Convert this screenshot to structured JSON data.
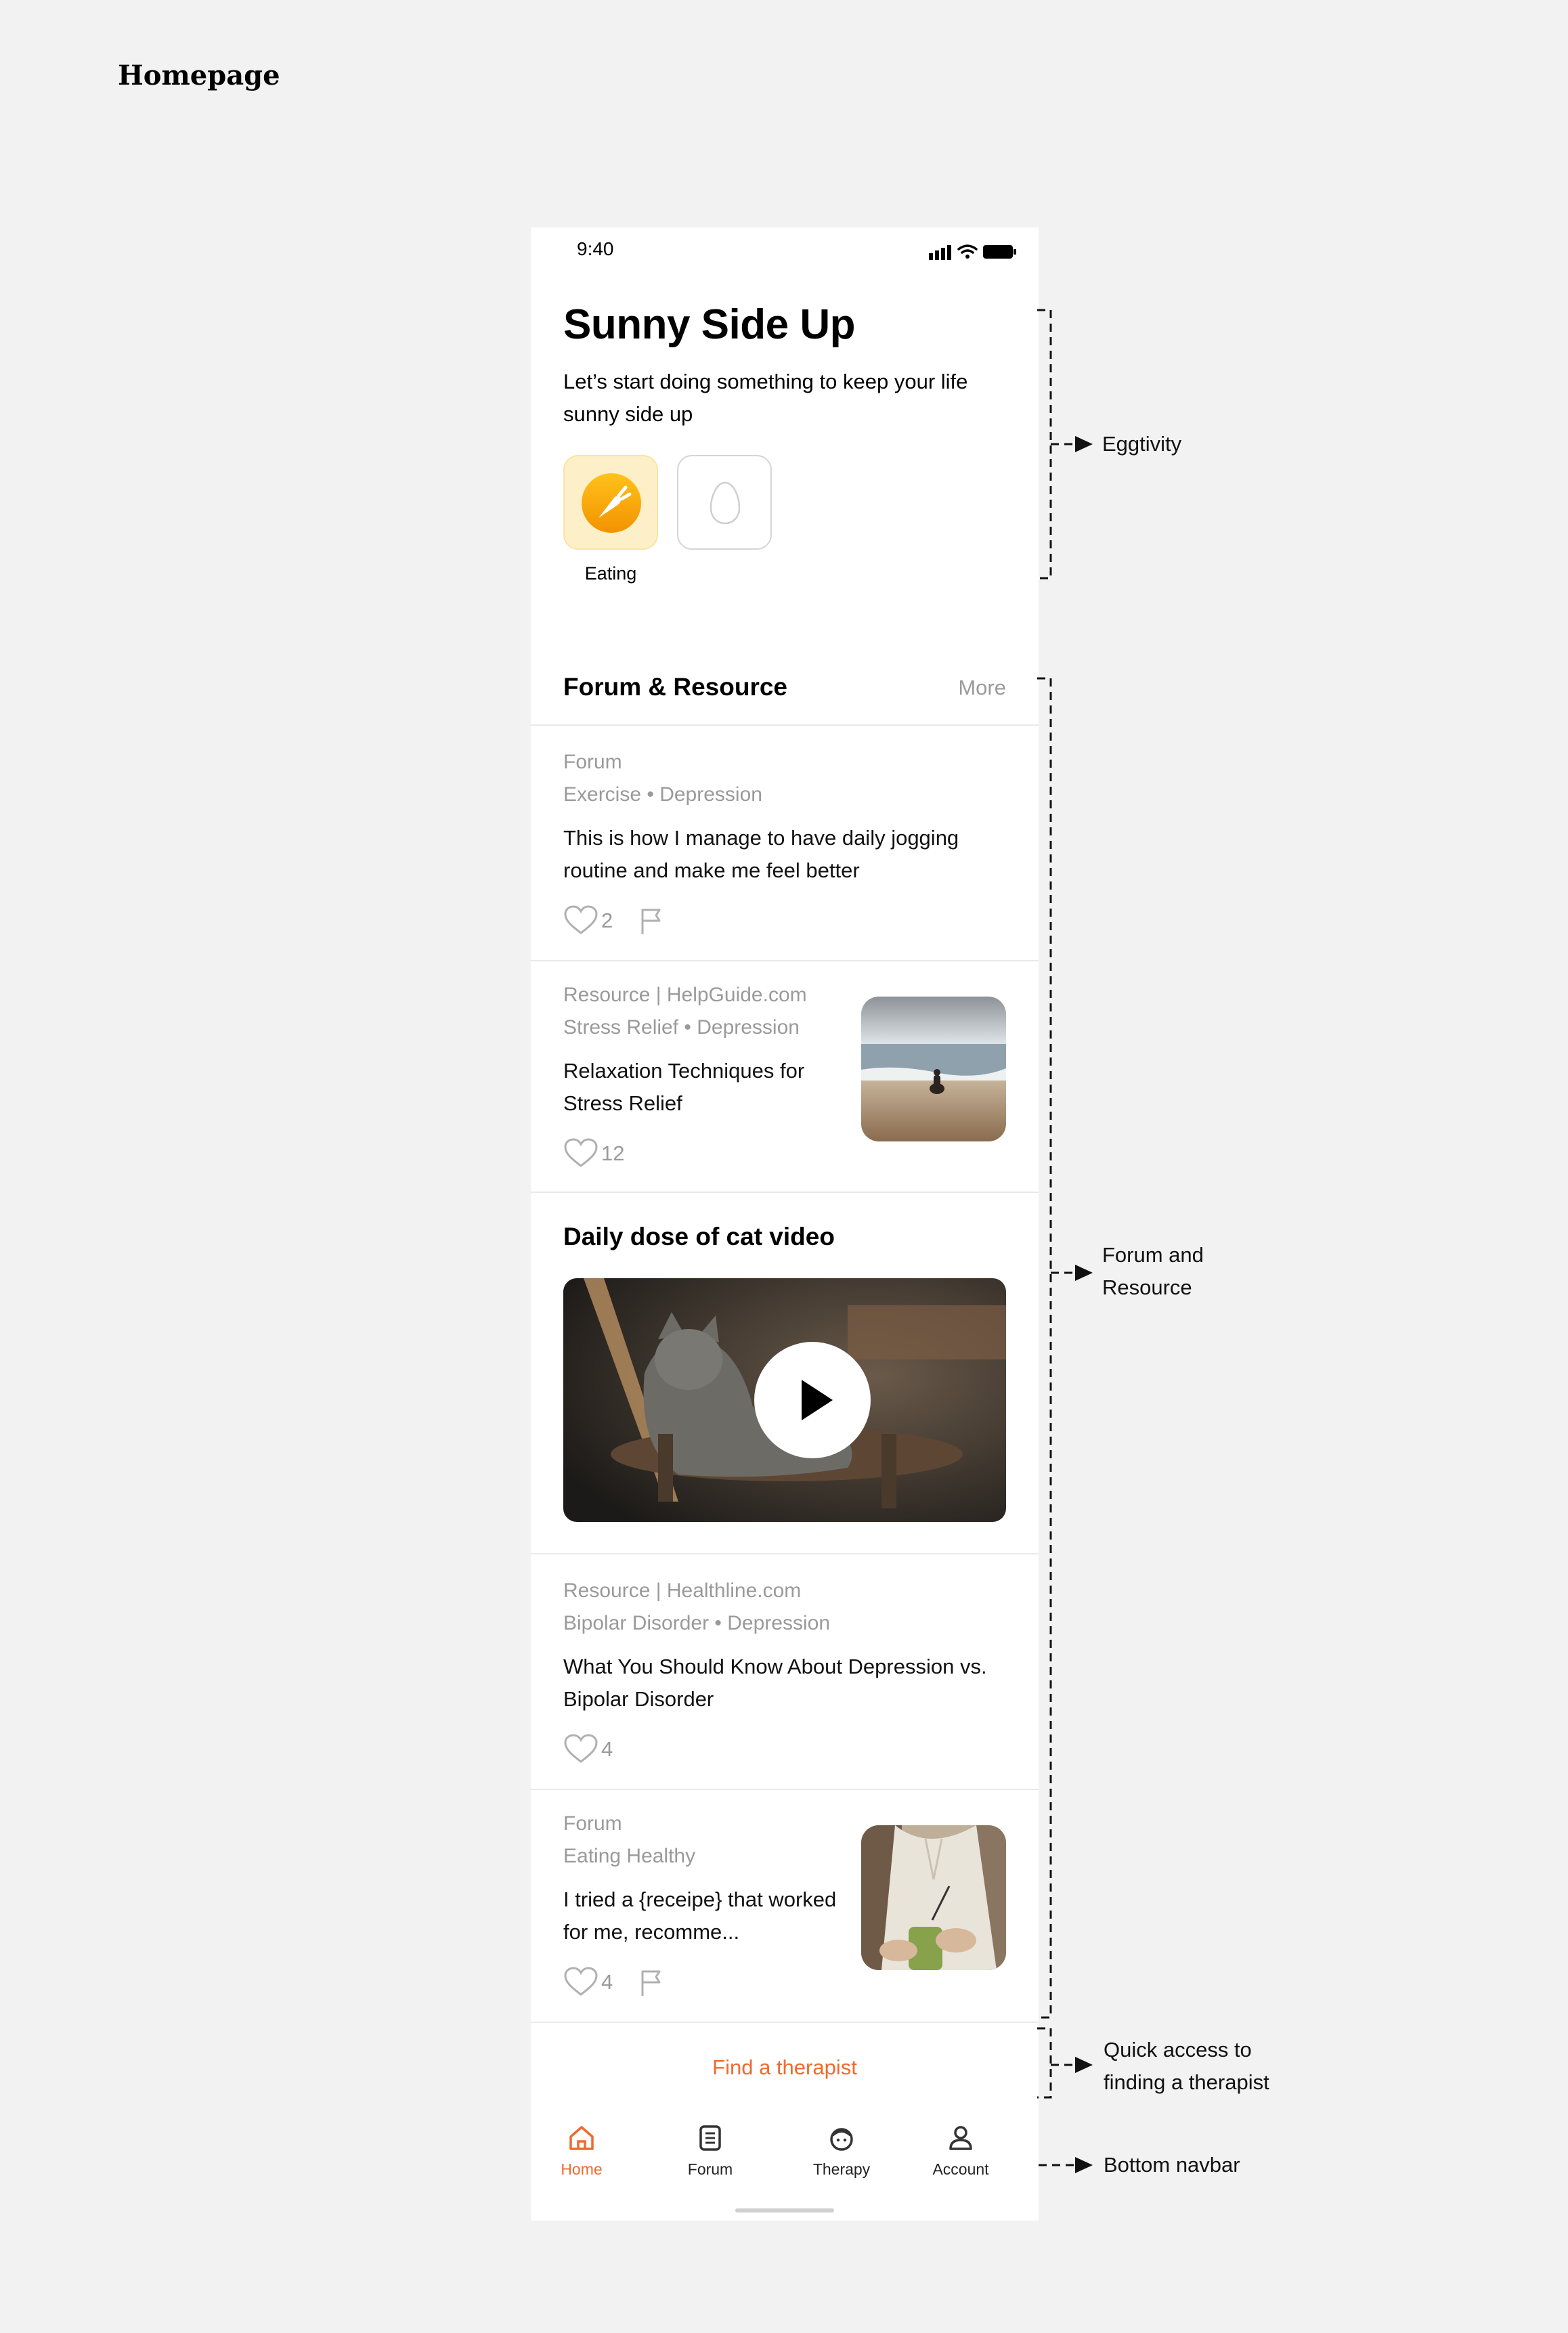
{
  "page_title": "Homepage",
  "status_bar": {
    "time": "9:40"
  },
  "header": {
    "title": "Sunny Side Up",
    "subtitle": "Let’s start doing something to keep your life sunny side up"
  },
  "eggtivity": {
    "items": [
      {
        "label": "Eating",
        "icon": "carrot-icon",
        "state": "active"
      },
      {
        "label": "",
        "icon": "egg-outline-icon",
        "state": "empty"
      }
    ]
  },
  "forum_section": {
    "title": "Forum & Resource",
    "more_label": "More",
    "posts": [
      {
        "source": "Forum",
        "tags": "Exercise • Depression",
        "title": "This is how I manage to have daily jogging routine and make me feel better",
        "likes": "2",
        "has_flag": true,
        "image": ""
      },
      {
        "source": "Resource | HelpGuide.com",
        "tags": "Stress Relief • Depression",
        "title": "Relaxation Techniques for Stress Relief",
        "likes": "12",
        "has_flag": false,
        "image": "beach-photo"
      },
      {
        "source": "Resource | Healthline.com",
        "tags": "Bipolar Disorder • Depression",
        "title": "What You Should Know About Depression vs. Bipolar Disorder",
        "likes": "4",
        "has_flag": false,
        "image": ""
      },
      {
        "source": "Forum",
        "tags": "Eating Healthy",
        "title": "I tried a {receipe} that worked for me, recomme...",
        "likes": "4",
        "has_flag": true,
        "image": "drink-photo"
      }
    ]
  },
  "video_section": {
    "title": "Daily dose of cat video",
    "thumbnail": "cat-on-chair-photo"
  },
  "find_therapist_label": "Find a therapist",
  "bottom_nav": {
    "items": [
      {
        "label": "Home",
        "icon": "home-icon",
        "active": true
      },
      {
        "label": "Forum",
        "icon": "document-icon",
        "active": false
      },
      {
        "label": "Therapy",
        "icon": "therapy-icon",
        "active": false
      },
      {
        "label": "Account",
        "icon": "user-icon",
        "active": false
      }
    ]
  },
  "annotations": {
    "eggtivity": "Eggtivity",
    "forum_resource_line1": "Forum and",
    "forum_resource_line2": "Resource",
    "therapist_line1": "Quick access to",
    "therapist_line2": "finding a therapist",
    "navbar": "Bottom navbar"
  },
  "colors": {
    "accent": "#ef6a2e",
    "egg_tile_bg": "#fdf0c8",
    "egg_icon": "#f5a300",
    "muted_text": "#9a9a9a"
  }
}
